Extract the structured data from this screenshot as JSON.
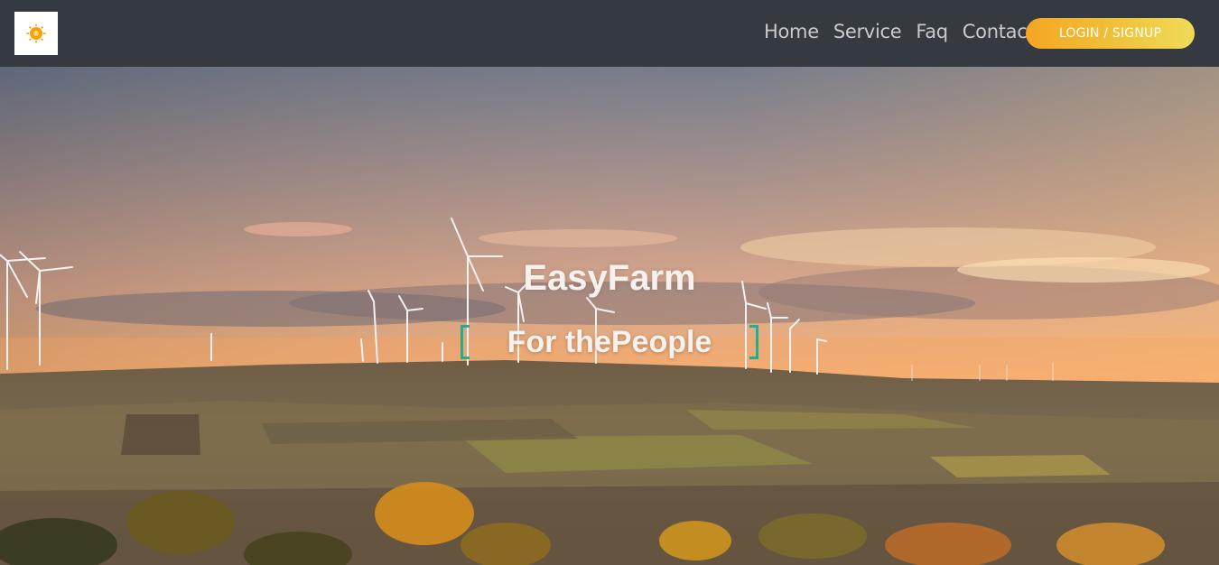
{
  "nav": {
    "links": [
      {
        "label": "Home"
      },
      {
        "label": "Service"
      },
      {
        "label": "Faq"
      },
      {
        "label": "Contact"
      }
    ],
    "login_label": "LOGIN / SIGNUP"
  },
  "hero": {
    "title": "EasyFarm",
    "subtitle_prefix": "For the",
    "subtitle_highlight": "People"
  },
  "colors": {
    "navbar": "#343a40",
    "accent_gradient_start": "#f5a623",
    "accent_gradient_end": "#efdc5a",
    "bracket": "#20b08e"
  },
  "icons": {
    "logo": "sun-icon"
  }
}
